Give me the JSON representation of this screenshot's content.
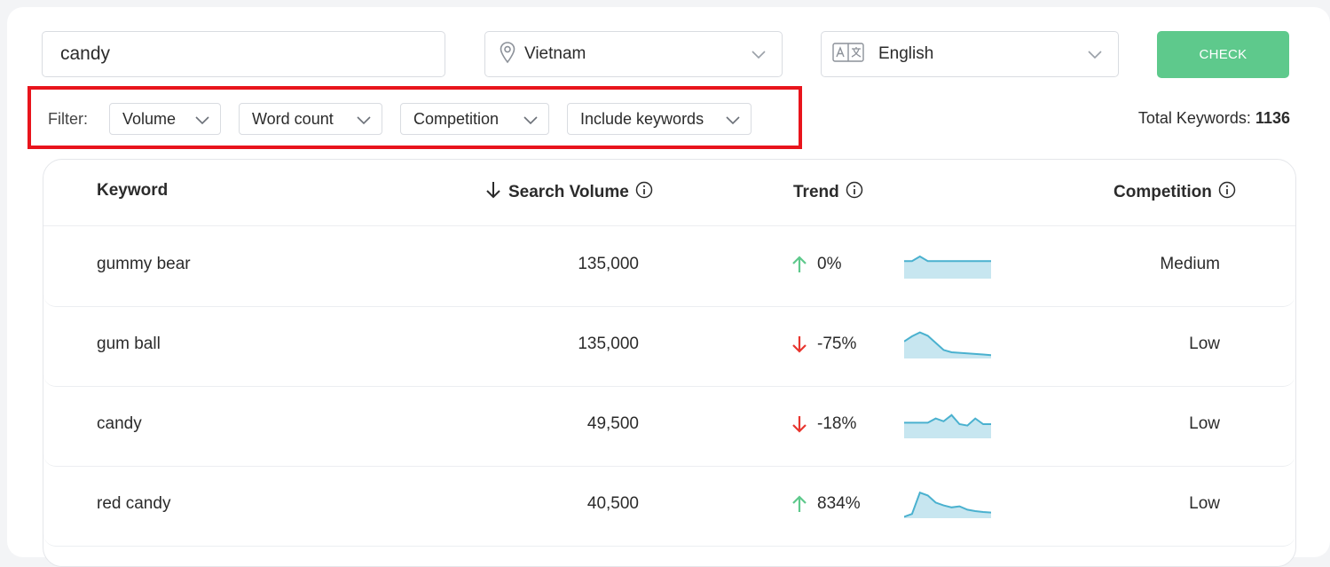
{
  "search": {
    "value": "candy"
  },
  "location": {
    "selected": "Vietnam",
    "icon": "map-pin-icon"
  },
  "language": {
    "selected": "English",
    "icon": "translate-icon"
  },
  "check_button": {
    "label": "CHECK",
    "color": "#5ec98c"
  },
  "filters": {
    "label": "Filter:",
    "items": [
      {
        "label": "Volume"
      },
      {
        "label": "Word count"
      },
      {
        "label": "Competition"
      },
      {
        "label": "Include keywords"
      }
    ],
    "highlight_color": "#e8141c"
  },
  "total_keywords": {
    "label": "Total Keywords:",
    "value": "1136"
  },
  "table": {
    "columns": {
      "keyword": "Keyword",
      "search_volume": "Search Volume",
      "trend": "Trend",
      "competition": "Competition"
    },
    "sort": {
      "column": "search_volume",
      "direction": "descending"
    },
    "rows": [
      {
        "keyword": "gummy bear",
        "volume": "135,000",
        "trend_dir": "up",
        "trend_pct": "0%",
        "competition": "Medium",
        "sparkline": [
          0.62,
          0.62,
          0.78,
          0.62,
          0.62,
          0.62,
          0.62,
          0.62,
          0.62,
          0.62,
          0.62,
          0.62
        ]
      },
      {
        "keyword": "gum ball",
        "volume": "135,000",
        "trend_dir": "down",
        "trend_pct": "-75%",
        "competition": "Low",
        "sparkline": [
          0.6,
          0.78,
          0.92,
          0.8,
          0.55,
          0.3,
          0.22,
          0.2,
          0.18,
          0.16,
          0.14,
          0.12
        ]
      },
      {
        "keyword": "candy",
        "volume": "49,500",
        "trend_dir": "down",
        "trend_pct": "-18%",
        "competition": "Low",
        "sparkline": [
          0.55,
          0.55,
          0.55,
          0.55,
          0.7,
          0.6,
          0.82,
          0.5,
          0.45,
          0.7,
          0.5,
          0.5
        ]
      },
      {
        "keyword": "red candy",
        "volume": "40,500",
        "trend_dir": "up",
        "trend_pct": "834%",
        "competition": "Low",
        "sparkline": [
          0.05,
          0.15,
          0.9,
          0.8,
          0.55,
          0.45,
          0.38,
          0.42,
          0.3,
          0.25,
          0.22,
          0.2
        ]
      }
    ],
    "colors": {
      "up": "#5ec98c",
      "down": "#e8362f",
      "spark_line": "#4ab1cf",
      "spark_fill": "#c7e6f0"
    }
  }
}
